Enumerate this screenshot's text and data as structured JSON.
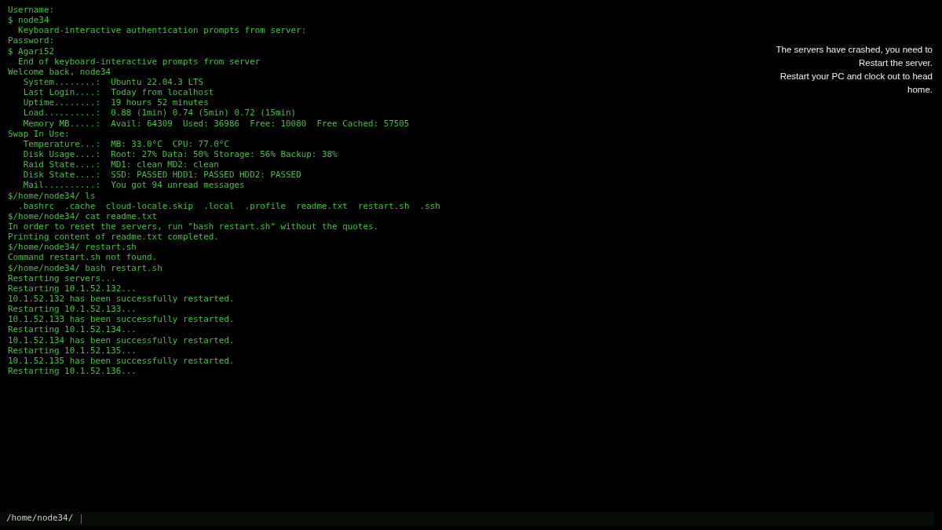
{
  "terminal": {
    "lines": [
      {
        "kind": "plain",
        "text": "Username:"
      },
      {
        "kind": "plain",
        "text": "$ node34"
      },
      {
        "kind": "sub",
        "text": "Keyboard-interactive authentication prompts from server:"
      },
      {
        "kind": "plain",
        "text": "Password:"
      },
      {
        "kind": "plain",
        "text": "$ Agari52"
      },
      {
        "kind": "sub",
        "text": "End of keyboard-interactive prompts from server"
      },
      {
        "kind": "plain",
        "text": "Welcome back, node34"
      },
      {
        "kind": "stat",
        "label": "System........:",
        "value": "Ubuntu 22.04.3 LTS"
      },
      {
        "kind": "stat",
        "label": "Last Login....:",
        "value": "Today from localhost"
      },
      {
        "kind": "stat",
        "label": "Uptime........:",
        "value": "19 hours 52 minutes"
      },
      {
        "kind": "stat",
        "label": "Load..........:",
        "value": "0.88 (1min) 0.74 (5min) 0.72 (15min)"
      },
      {
        "kind": "stat",
        "label": "Memory MB.....:",
        "value": "Avail: 64309  Used: 36986  Free: 10080  Free Cached: 57505"
      },
      {
        "kind": "plain",
        "text": "Swap In Use:"
      },
      {
        "kind": "stat",
        "label": "Temperature...:",
        "value": "MB: 33.0°C  CPU: 77.0°C"
      },
      {
        "kind": "stat",
        "label": "Disk Usage....:",
        "value": "Root: 27% Data: 50% Storage: 56% Backup: 38%"
      },
      {
        "kind": "stat",
        "label": "Raid State....:",
        "value": "MD1: clean MD2: clean"
      },
      {
        "kind": "stat",
        "label": "Disk State....:",
        "value": "SSD: PASSED HDD1: PASSED HDD2: PASSED"
      },
      {
        "kind": "stat",
        "label": "Mail..........:",
        "value": "You got 94 unread messages"
      },
      {
        "kind": "plain",
        "text": "$/home/node34/ ls"
      },
      {
        "kind": "listing",
        "items": [
          ".bashrc",
          ".cache",
          "cloud-locale.skip",
          ".local",
          ".profile",
          "readme.txt",
          "restart.sh",
          ".ssh"
        ]
      },
      {
        "kind": "plain",
        "text": "$/home/node34/ cat readme.txt"
      },
      {
        "kind": "plain",
        "text": "In order to reset the servers, run \"bash restart.sh\" without the quotes."
      },
      {
        "kind": "plain",
        "text": "Printing content of readme.txt completed."
      },
      {
        "kind": "plain",
        "text": "$/home/node34/ restart.sh"
      },
      {
        "kind": "plain",
        "text": "Command restart.sh not found."
      },
      {
        "kind": "plain",
        "text": "$/home/node34/ bash restart.sh"
      },
      {
        "kind": "plain",
        "text": "Restarting servers..."
      },
      {
        "kind": "plain",
        "text": "Restarting 10.1.52.132..."
      },
      {
        "kind": "plain",
        "text": "10.1.52.132 has been successfully restarted."
      },
      {
        "kind": "plain",
        "text": "Restarting 10.1.52.133..."
      },
      {
        "kind": "plain",
        "text": "10.1.52.133 has been successfully restarted."
      },
      {
        "kind": "plain",
        "text": "Restarting 10.1.52.134..."
      },
      {
        "kind": "plain",
        "text": "10.1.52.134 has been successfully restarted."
      },
      {
        "kind": "plain",
        "text": "Restarting 10.1.52.135..."
      },
      {
        "kind": "plain",
        "text": "10.1.52.135 has been successfully restarted."
      },
      {
        "kind": "plain",
        "text": "Restarting 10.1.52.136..."
      }
    ]
  },
  "notice": {
    "paragraphs": [
      "The servers have crashed, you need to Restart the server.",
      "Restart your PC and clock out to head home."
    ]
  },
  "command_line": {
    "prompt": "/home/node34/"
  }
}
